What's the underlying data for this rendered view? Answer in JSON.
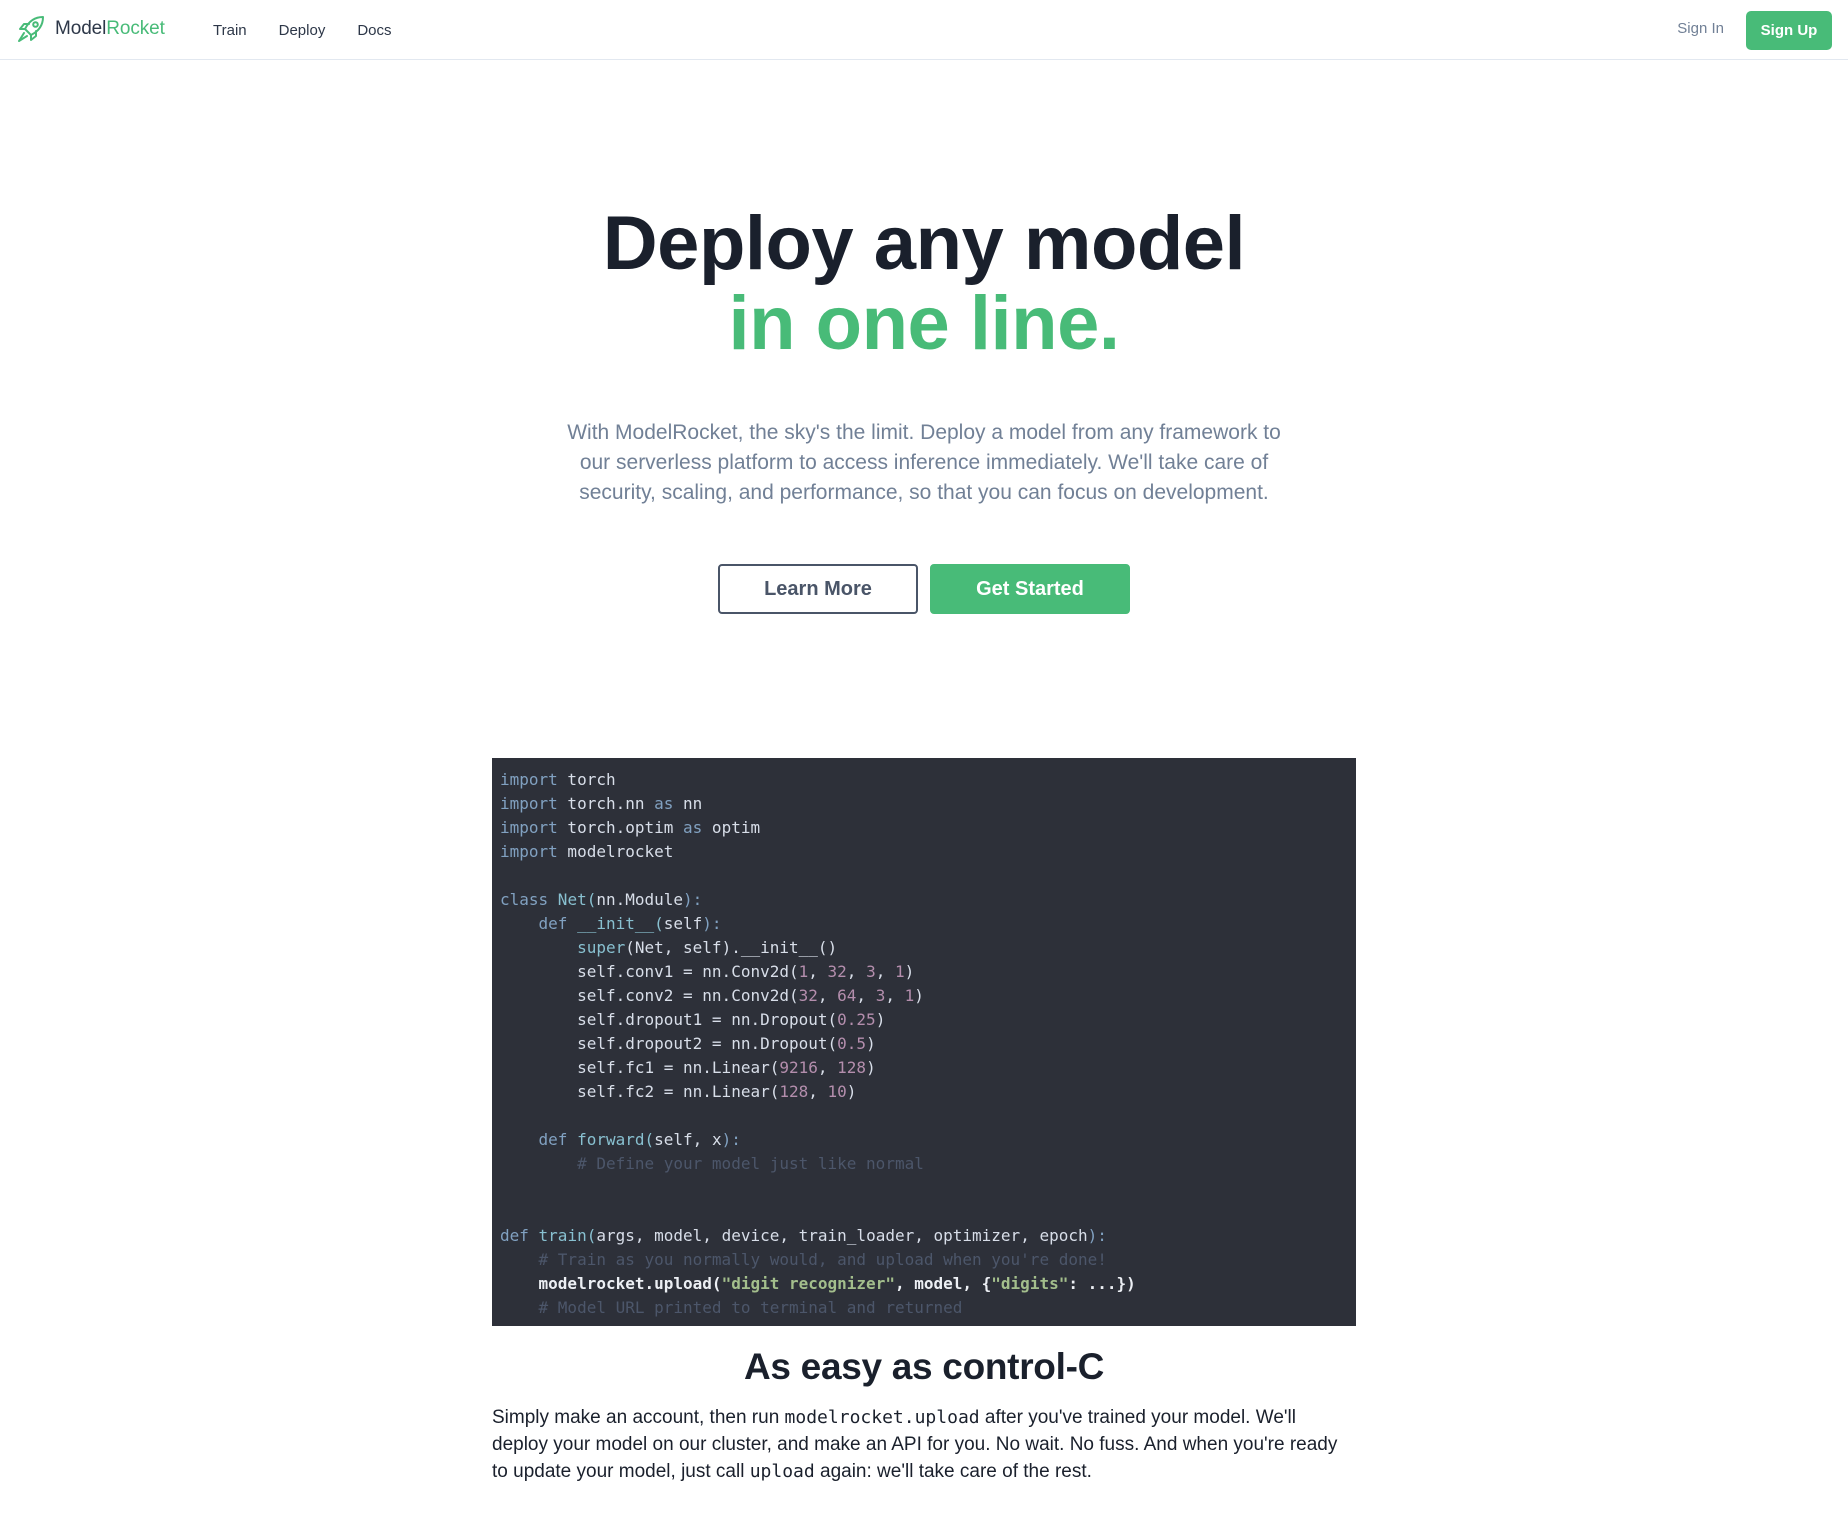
{
  "nav": {
    "brand_main": "Model",
    "brand_accent": "Rocket",
    "brand_icon": "rocket-icon",
    "links": [
      "Train",
      "Deploy",
      "Docs"
    ],
    "sign_in": "Sign In",
    "sign_up": "Sign Up"
  },
  "hero": {
    "title_line1": "Deploy any model",
    "title_line2": "in one line.",
    "description": "With ModelRocket, the sky's the limit. Deploy a model from any framework to our serverless platform to access inference immediately. We'll take care of security, scaling, and performance, so that you can focus on development.",
    "learn_more": "Learn More",
    "get_started": "Get Started"
  },
  "code": {
    "l1_kw": "import",
    "l1_rest": " torch",
    "l2_kw": "import",
    "l2_mid": " torch.nn ",
    "l2_as": "as",
    "l2_rest": " nn",
    "l3_kw": "import",
    "l3_mid": " torch.optim ",
    "l3_as": "as",
    "l3_rest": " optim",
    "l4_kw": "import",
    "l4_rest": " modelrocket",
    "l6_kw": "class",
    "l6_name": " Net(",
    "l6_arg": "nn.Module",
    "l6_end": "):",
    "l7_kw": "    def",
    "l7_name": " __init__(",
    "l7_arg": "self",
    "l7_end": "):",
    "l8_fn": "        super",
    "l8_rest": "(Net, self).__init__()",
    "l9_a": "        self.conv1 = nn.Conv2d(",
    "l9_n1": "1",
    "l9_s1": ", ",
    "l9_n2": "32",
    "l9_s2": ", ",
    "l9_n3": "3",
    "l9_s3": ", ",
    "l9_n4": "1",
    "l9_e": ")",
    "l10_a": "        self.conv2 = nn.Conv2d(",
    "l10_n1": "32",
    "l10_s1": ", ",
    "l10_n2": "64",
    "l10_s2": ", ",
    "l10_n3": "3",
    "l10_s3": ", ",
    "l10_n4": "1",
    "l10_e": ")",
    "l11_a": "        self.dropout1 = nn.Dropout(",
    "l11_n1": "0.25",
    "l11_e": ")",
    "l12_a": "        self.dropout2 = nn.Dropout(",
    "l12_n1": "0.5",
    "l12_e": ")",
    "l13_a": "        self.fc1 = nn.Linear(",
    "l13_n1": "9216",
    "l13_s1": ", ",
    "l13_n2": "128",
    "l13_e": ")",
    "l14_a": "        self.fc2 = nn.Linear(",
    "l14_n1": "128",
    "l14_s1": ", ",
    "l14_n2": "10",
    "l14_e": ")",
    "l16_kw": "    def",
    "l16_name": " forward(",
    "l16_arg": "self, x",
    "l16_end": "):",
    "l17_cm": "        # Define your model just like normal",
    "l20_kw": "def",
    "l20_name": " train(",
    "l20_arg": "args, model, device, train_loader, optimizer, epoch",
    "l20_end": "):",
    "l21_cm": "    # Train as you normally would, and upload when you're done!",
    "l22_a": "    modelrocket.upload(",
    "l22_s1": "\"digit recognizer\"",
    "l22_b": ", model, {",
    "l22_s2": "\"digits\"",
    "l22_c": ": ...})",
    "l23_cm": "    # Model URL printed to terminal and returned"
  },
  "section": {
    "title": "As easy as control-C",
    "p1": "Simply make an account, then run ",
    "c1": "modelrocket.upload",
    "p2": " after you've trained your model. We'll deploy your model on our cluster, and make an API for you. No wait. No fuss. And when you're ready to update your model, just call ",
    "c2": "upload",
    "p3": " again: we'll take care of the rest."
  },
  "colors": {
    "brand": "#48bb78",
    "text": "#1a202c",
    "muted": "#718096",
    "code_bg": "#2d3039"
  }
}
